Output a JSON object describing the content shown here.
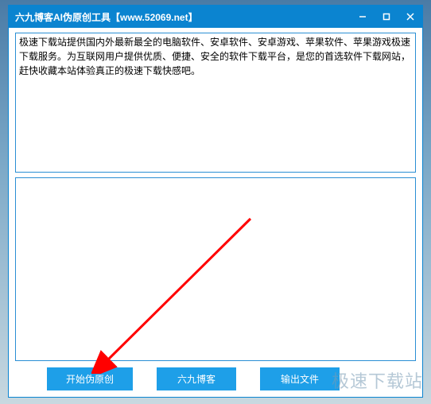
{
  "titlebar": {
    "title": "六九博客AI伪原创工具【www.52069.net】"
  },
  "input": {
    "value": "极速下载站提供国内外最新最全的电脑软件、安卓软件、安卓游戏、苹果软件、苹果游戏极速下载服务。为互联网用户提供优质、便捷、安全的软件下载平台，是您的首选软件下载网站，赶快收藏本站体验真正的极速下载快感吧。"
  },
  "output": {
    "value": ""
  },
  "buttons": {
    "start": "开始伪原创",
    "blog": "六九博客",
    "export": "输出文件"
  },
  "watermark": "极速下载站"
}
